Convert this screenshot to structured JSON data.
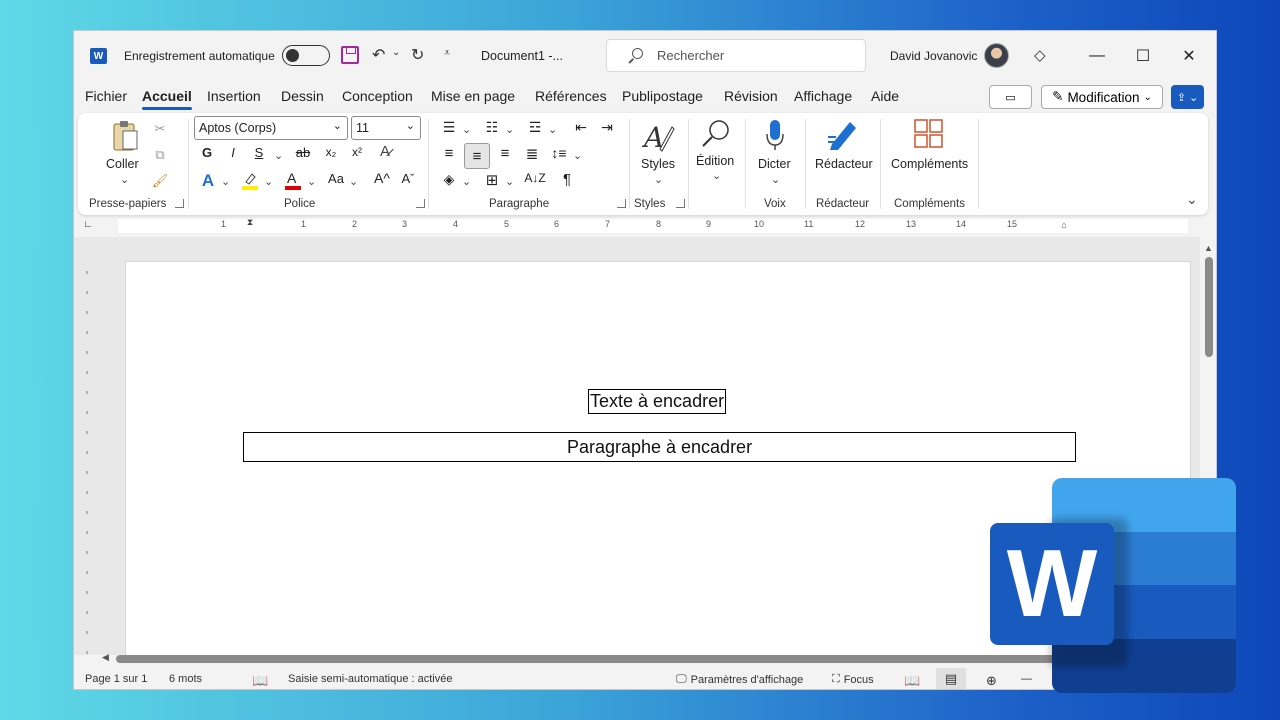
{
  "titlebar": {
    "app_icon": "W",
    "autosave_label": "Enregistrement automatique",
    "doc_title": "Document1  -...",
    "search_placeholder": "Rechercher",
    "user_name": "David Jovanovic"
  },
  "menu": {
    "tabs": [
      "Fichier",
      "Accueil",
      "Insertion",
      "Dessin",
      "Conception",
      "Mise en page",
      "Références",
      "Publipostage",
      "Révision",
      "Affichage",
      "Aide"
    ],
    "active": "Accueil",
    "modification_label": "Modification"
  },
  "ribbon": {
    "clipboard": {
      "paste_label": "Coller",
      "group": "Presse-papiers"
    },
    "font": {
      "font_name": "Aptos (Corps)",
      "font_size": "11",
      "group": "Police",
      "bold": "G",
      "italic": "I",
      "underline": "S",
      "strike": "ab",
      "sub": "x₂",
      "sup": "x²",
      "case": "Aa"
    },
    "paragraph": {
      "group": "Paragraphe",
      "pilcrow": "¶"
    },
    "styles": {
      "label": "Styles",
      "group": "Styles"
    },
    "editing": {
      "label": "Édition"
    },
    "voice": {
      "label": "Dicter",
      "group": "Voix"
    },
    "editor": {
      "label": "Rédacteur",
      "group": "Rédacteur"
    },
    "addins": {
      "label": "Compléments",
      "group": "Compléments"
    }
  },
  "ruler": {
    "numbers": [
      "1",
      "1",
      "2",
      "3",
      "4",
      "5",
      "6",
      "7",
      "8",
      "9",
      "10",
      "11",
      "12",
      "13",
      "14",
      "15"
    ]
  },
  "document": {
    "boxed_text": "Texte à encadrer",
    "boxed_paragraph": "Paragraphe à encadrer"
  },
  "status": {
    "page": "Page 1 sur 1",
    "words": "6 mots",
    "autocomplete": "Saisie semi-automatique : activée",
    "display_settings": "Paramètres d'affichage",
    "focus": "Focus"
  },
  "logo": {
    "letter": "W"
  },
  "colors": {
    "accent": "#185abd",
    "save_icon": "#a4289b"
  }
}
